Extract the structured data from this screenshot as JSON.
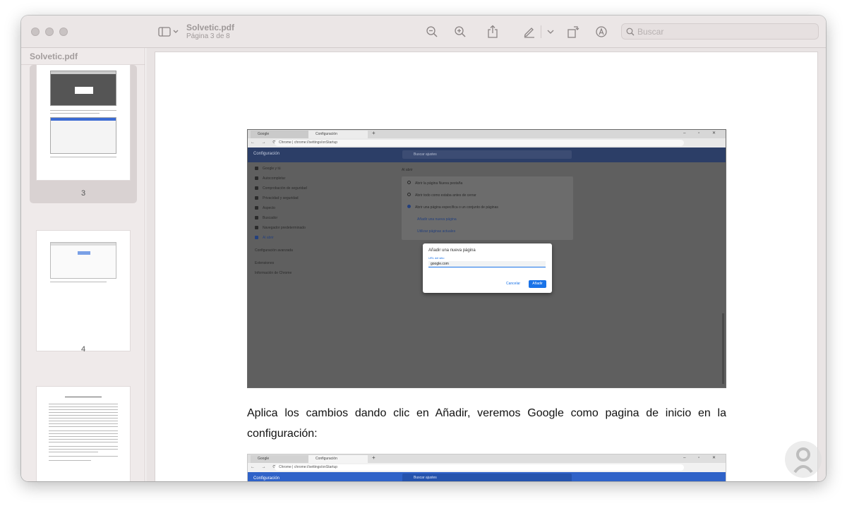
{
  "window": {
    "doc_title": "Solvetic.pdf",
    "page_indicator": "Página 3 de 8",
    "search_placeholder": "Buscar"
  },
  "sidebar": {
    "title": "Solvetic.pdf",
    "pages": [
      {
        "number": "3",
        "selected": true
      },
      {
        "number": "4",
        "selected": false
      },
      {
        "number": "",
        "selected": false
      }
    ]
  },
  "content": {
    "screenshot": {
      "tabs": [
        "Google",
        "Configuración"
      ],
      "url": "Chrome | chrome://settings/onStartup",
      "header_title": "Configuración",
      "search_placeholder": "Buscar ajustes",
      "sidebar_items": [
        "Google y tú",
        "Autocompletar",
        "Comprobación de seguridad",
        "Privacidad y seguridad",
        "Aspecto",
        "Buscador",
        "Navegador predeterminado",
        "Al abrir",
        "Configuración avanzada",
        "Extensiones",
        "Información de Chrome"
      ],
      "section_title": "Al abrir",
      "options": [
        "Abrir la página Nueva pestaña",
        "Abrir todo como estaba antes de cerrar",
        "Abrir una página específica o un conjunto de páginas",
        "Añadir una nueva página",
        "Utilizar páginas actuales"
      ],
      "dialog": {
        "title": "Añadir una nueva página",
        "field_label": "URL del sitio",
        "field_value": "google.com",
        "cancel": "Cancelar",
        "add": "Añadir"
      }
    },
    "paragraph": "Aplica los cambios dando clic en Añadir, veremos Google como pagina de inicio en la configuración:",
    "screenshot2": {
      "tabs": [
        "Google",
        "Configuración"
      ],
      "url": "Chrome | chrome://settings/onStartup",
      "header_title": "Configuración",
      "search_placeholder": "Buscar ajustes"
    }
  }
}
